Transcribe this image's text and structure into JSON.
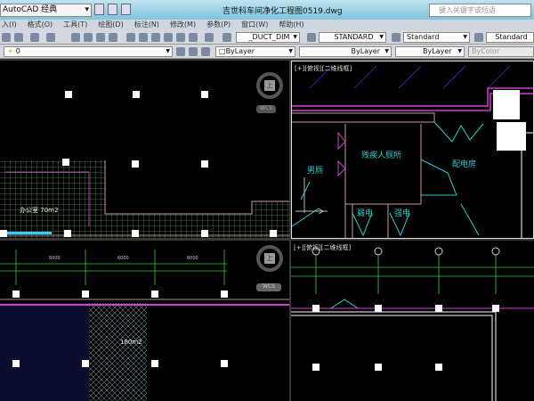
{
  "title_bar": {
    "workspace": "AutoCAD 经典",
    "file_title": "吉世科车间净化工程图0519.dwg",
    "search_placeholder": "键入关键字或短语"
  },
  "menu": [
    "入(I)",
    "格式(O)",
    "工具(T)",
    "绘图(D)",
    "标注(N)",
    "修改(M)",
    "参数(P)",
    "窗口(W)",
    "帮助(H)"
  ],
  "toolbar": {
    "dim_style": "_DUCT_DIM",
    "text_style": "STANDARD",
    "table_style": "Standard",
    "multileader_style": "Standard",
    "layer": "0",
    "color": "ByLayer",
    "linetype": "ByLayer",
    "lineweight": "ByLayer",
    "plot_style": "ByColor"
  },
  "viewports": {
    "top_left": {
      "room_label": "办公室 70m2",
      "viewcube_top": "上",
      "wcs": "WCS"
    },
    "top_right": {
      "label": "[+][俯视][二维线框]",
      "rooms": [
        "男厕",
        "残疾人厕所",
        "配电房",
        "弱电",
        "强电"
      ]
    },
    "bottom_left": {
      "area_label": "180m2",
      "viewcube_top": "上",
      "wcs": "WCS",
      "dims": [
        "6000",
        "6000",
        "6000"
      ]
    },
    "bottom_right": {
      "label": "[+][俯视][二维线框]"
    }
  }
}
